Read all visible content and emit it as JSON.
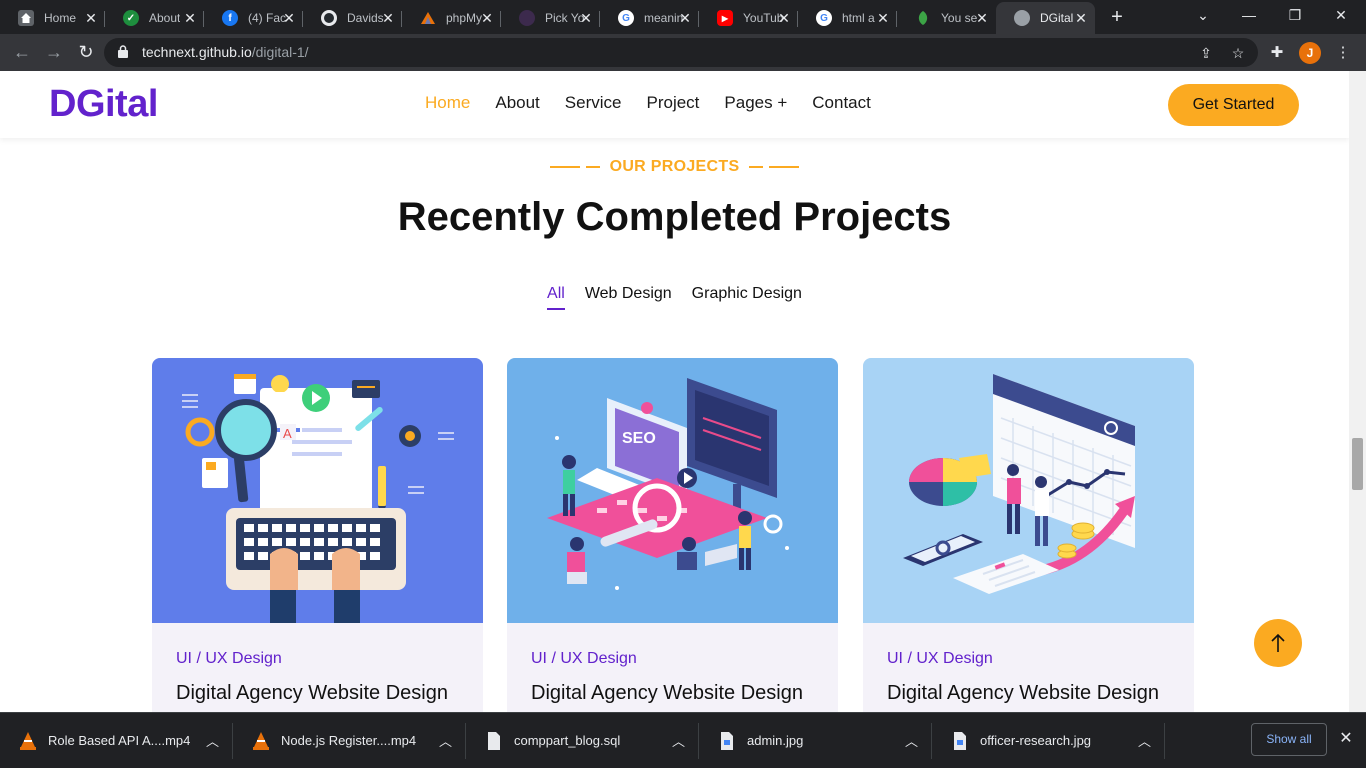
{
  "browser": {
    "tabs": [
      {
        "title": "Home",
        "icon": "tab-home-icon",
        "color": "#5f6368"
      },
      {
        "title": "About",
        "icon": "tab-check-icon",
        "color": "#1e8e3e"
      },
      {
        "title": "(4) Fac",
        "icon": "tab-facebook-icon",
        "color": "#1877f2"
      },
      {
        "title": "Davids",
        "icon": "tab-github-icon",
        "color": "#24292e"
      },
      {
        "title": "phpMy",
        "icon": "tab-phpmyadmin-icon",
        "color": "#e8710a"
      },
      {
        "title": "Pick Yo",
        "icon": "tab-pickyo-icon",
        "color": "#3c2a4d"
      },
      {
        "title": "meanin",
        "icon": "tab-google-icon",
        "color": "#ffffff"
      },
      {
        "title": "YouTub",
        "icon": "tab-youtube-icon",
        "color": "#ff0000"
      },
      {
        "title": "html a",
        "icon": "tab-google-icon",
        "color": "#ffffff"
      },
      {
        "title": "You se",
        "icon": "tab-leaf-icon",
        "color": "#3ca446"
      },
      {
        "title": "DGital",
        "icon": "tab-globe-icon",
        "color": "#9aa0a6"
      }
    ],
    "url_host": "technext.github.io",
    "url_path": "/digital-1/",
    "profile_initial": "J"
  },
  "site": {
    "logo": "DGital",
    "nav": [
      "Home",
      "About",
      "Service",
      "Project",
      "Pages +",
      "Contact"
    ],
    "active_nav": "Home",
    "cta": "Get Started"
  },
  "projects": {
    "subtitle": "OUR PROJECTS",
    "title": "Recently Completed Projects",
    "filters": [
      "All",
      "Web Design",
      "Graphic Design"
    ],
    "active_filter": "All",
    "cards": [
      {
        "category": "UI / UX Design",
        "title": "Digital Agency Website Design",
        "bg": "#5f7dea"
      },
      {
        "category": "UI / UX Design",
        "title": "Digital Agency Website Design",
        "bg": "#6fb0ea"
      },
      {
        "category": "UI / UX Design",
        "title": "Digital Agency Website Design",
        "bg": "#a8d3f5"
      }
    ]
  },
  "downloads": {
    "items": [
      {
        "name": "Role Based API A....mp4",
        "icon": "vlc-icon"
      },
      {
        "name": "Node.js Register....mp4",
        "icon": "vlc-icon"
      },
      {
        "name": "comppart_blog.sql",
        "icon": "file-icon"
      },
      {
        "name": "admin.jpg",
        "icon": "image-file-icon"
      },
      {
        "name": "officer-research.jpg",
        "icon": "image-file-icon"
      }
    ],
    "show_all": "Show all"
  },
  "colors": {
    "brand": "#6222cc",
    "accent": "#fbaa21"
  }
}
